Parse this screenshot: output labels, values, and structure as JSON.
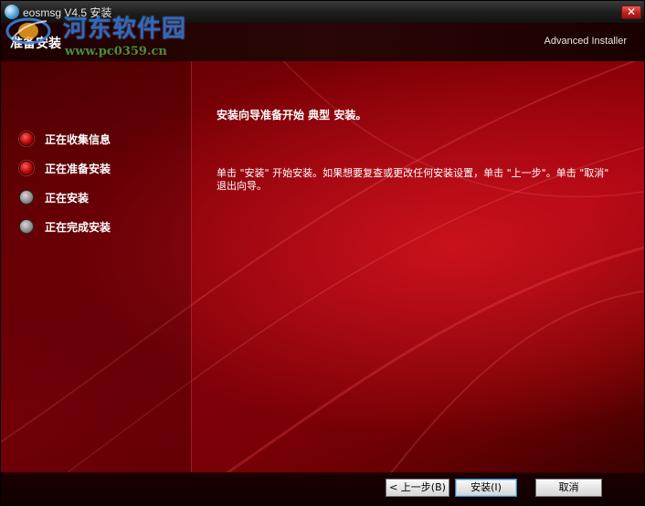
{
  "window": {
    "title": "eosmsg V4.5 安装",
    "close_symbol": "✕"
  },
  "watermark": {
    "site_name": "河东软件园",
    "url": "www.pc0359.cn"
  },
  "header": {
    "title": "准备安装",
    "brand": "Advanced Installer"
  },
  "steps": [
    {
      "label": "正在收集信息",
      "state": "active"
    },
    {
      "label": "正在准备安装",
      "state": "active"
    },
    {
      "label": "正在安装",
      "state": "inactive"
    },
    {
      "label": "正在完成安装",
      "state": "inactive"
    }
  ],
  "content": {
    "title": "安装向导准备开始 典型 安装。",
    "description": "单击 \"安装\" 开始安装。如果想要复查或更改任何安装设置，单击 \"上一步\"。单击 \"取消\" 退出向导。"
  },
  "buttons": {
    "back": "< 上一步(B)",
    "install": "安装(I)",
    "cancel": "取消"
  },
  "colors": {
    "accent_red": "#a3020f",
    "active_dot": "#b30000",
    "inactive_dot": "#8a8a8a"
  }
}
